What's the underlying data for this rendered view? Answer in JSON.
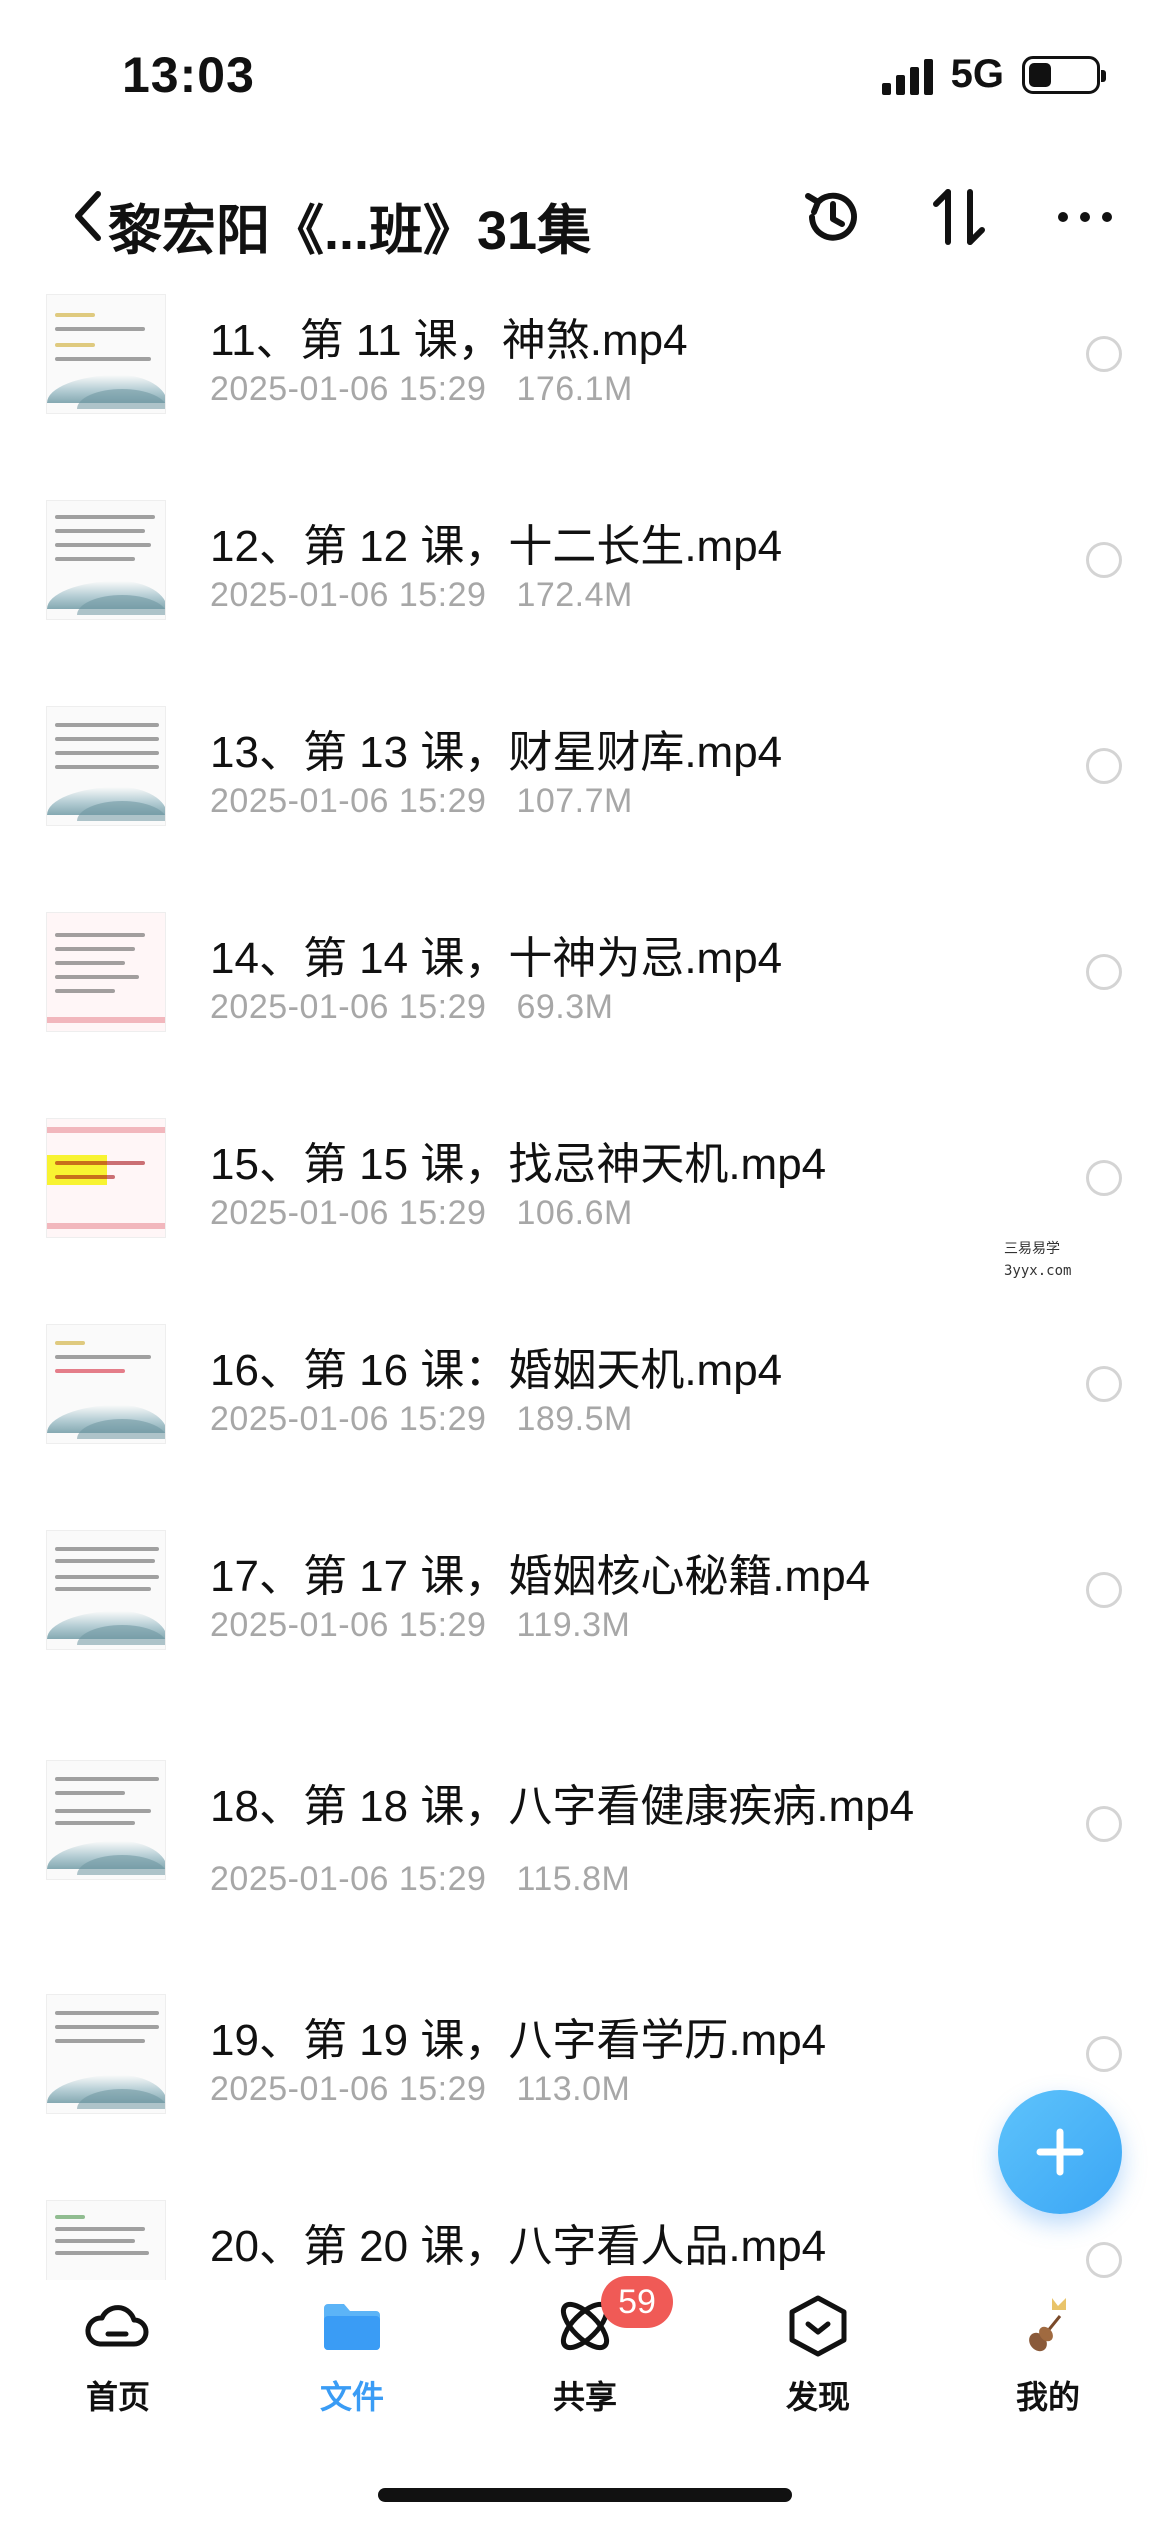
{
  "status_bar": {
    "time": "13:03",
    "network": "5G"
  },
  "nav": {
    "title": "黎宏阳《...班》31集"
  },
  "files": [
    {
      "name": "11、第 11 课，神煞.mp4",
      "date": "2025-01-06 15:29",
      "size": "176.1M"
    },
    {
      "name": "12、第 12 课，十二长生.mp4",
      "date": "2025-01-06 15:29",
      "size": "172.4M"
    },
    {
      "name": "13、第 13 课，财星财库.mp4",
      "date": "2025-01-06 15:29",
      "size": "107.7M"
    },
    {
      "name": "14、第 14 课，十神为忌.mp4",
      "date": "2025-01-06 15:29",
      "size": "69.3M"
    },
    {
      "name": "15、第 15 课，找忌神天机.mp4",
      "date": "2025-01-06 15:29",
      "size": "106.6M"
    },
    {
      "name": "16、第 16 课：婚姻天机.mp4",
      "date": "2025-01-06 15:29",
      "size": "189.5M"
    },
    {
      "name": "17、第 17 课，婚姻核心秘籍.mp4",
      "date": "2025-01-06 15:29",
      "size": "119.3M"
    },
    {
      "name": "18、第 18 课，八字看健康疾病.mp4",
      "date": "2025-01-06 15:29",
      "size": "115.8M"
    },
    {
      "name": "19、第 19 课，八字看学历.mp4",
      "date": "2025-01-06 15:29",
      "size": "113.0M"
    },
    {
      "name": "20、第 20 课，八字看人品.mp4",
      "date": "",
      "size": ""
    }
  ],
  "watermark": {
    "line1": "三易易学",
    "line2": "3yyx.com"
  },
  "tabs": [
    {
      "label": "首页",
      "icon": "cloud-icon"
    },
    {
      "label": "文件",
      "icon": "folder-icon"
    },
    {
      "label": "共享",
      "icon": "share-orbit-icon",
      "badge": "59"
    },
    {
      "label": "发现",
      "icon": "discover-icon"
    },
    {
      "label": "我的",
      "icon": "avatar"
    }
  ],
  "colors": {
    "accent": "#3a9cf5",
    "badge": "#f05a56",
    "meta": "#a7a7a7"
  }
}
